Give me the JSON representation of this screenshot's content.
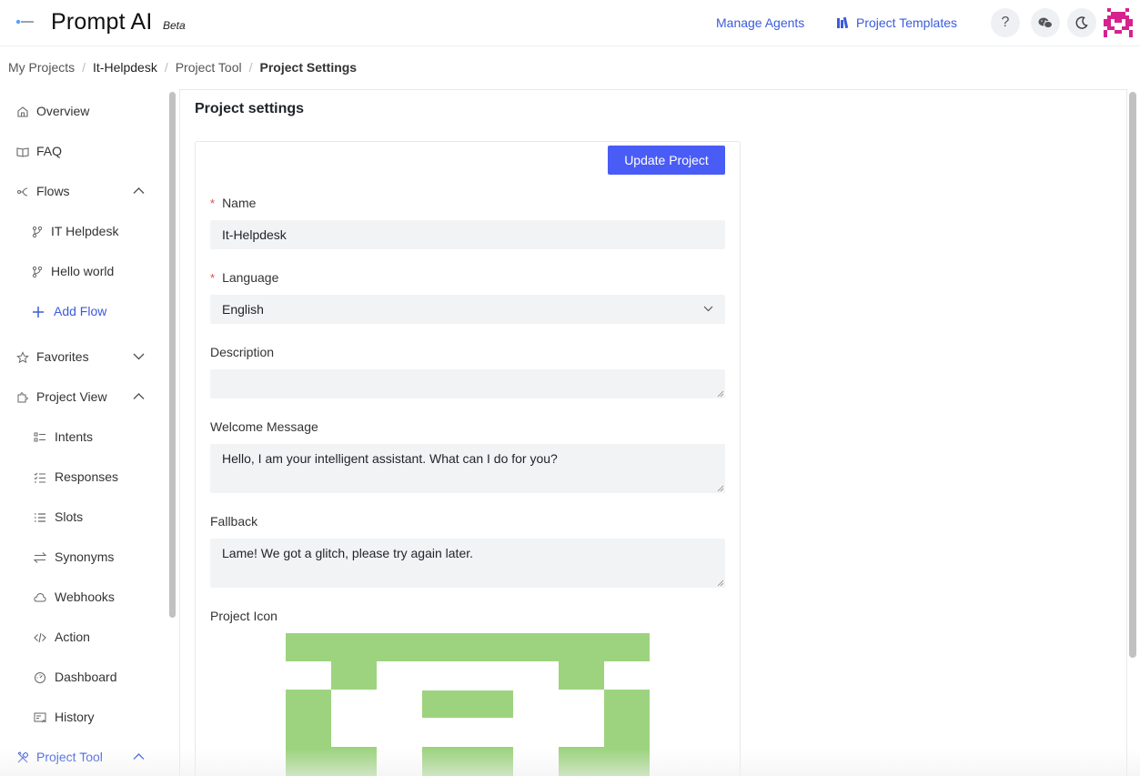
{
  "app": {
    "name": "Prompt AI",
    "badge": "Beta",
    "logo_text": "PromptAI"
  },
  "header": {
    "manage_agents": "Manage Agents",
    "project_templates": "Project Templates",
    "help_label": "?",
    "icons": [
      "help-icon",
      "wechat-icon",
      "moon-icon",
      "avatar"
    ],
    "accent": "#3b5bdb"
  },
  "breadcrumb": [
    "My Projects",
    "It-Helpdesk",
    "Project Tool",
    "Project Settings"
  ],
  "sidebar": {
    "overview": "Overview",
    "faq": "FAQ",
    "flows": "Flows",
    "flow_items": [
      "IT Helpdesk",
      "Hello world"
    ],
    "add_flow": "Add Flow",
    "favorites": "Favorites",
    "project_view": "Project View",
    "view_items": [
      "Intents",
      "Responses",
      "Slots",
      "Synonyms",
      "Webhooks",
      "Action",
      "Dashboard",
      "History"
    ],
    "project_tool": "Project Tool"
  },
  "main": {
    "title": "Project settings",
    "update_button": "Update Project",
    "name_label": "Name",
    "name_value": "It-Helpdesk",
    "language_label": "Language",
    "language_value": "English",
    "description_label": "Description",
    "description_value": "",
    "welcome_label": "Welcome Message",
    "welcome_value": "Hello, I am your intelligent assistant. What can I do for you?",
    "fallback_label": "Fallback",
    "fallback_value": "Lame! We got a glitch, please try again later.",
    "icon_label": "Project Icon",
    "icon_color": "#9dd37f",
    "button_color": "#4a5cf6"
  }
}
